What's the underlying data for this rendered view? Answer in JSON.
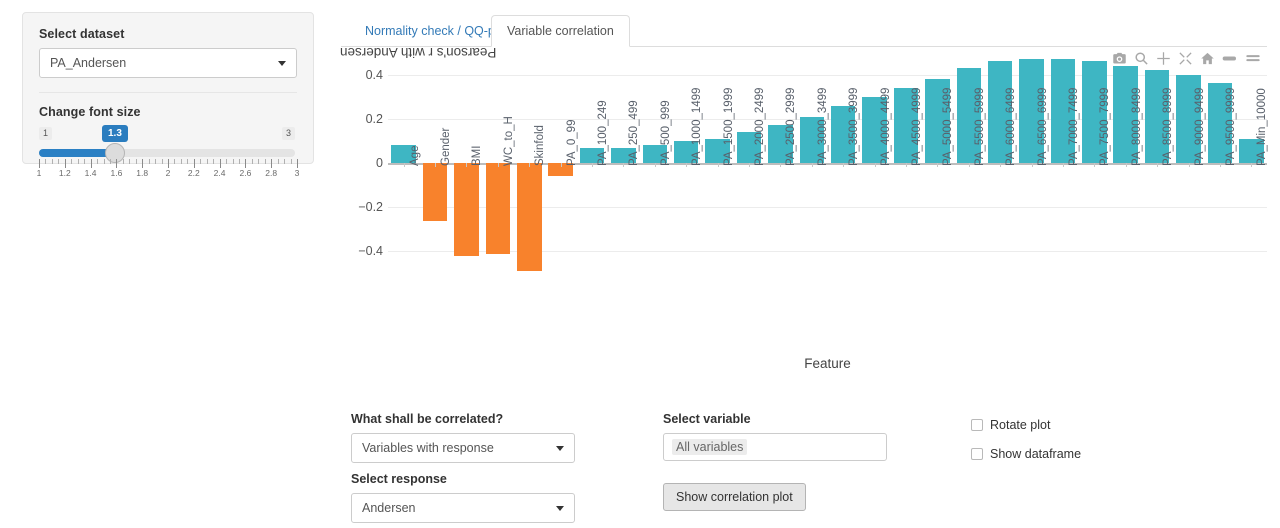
{
  "sidebar": {
    "dataset_label": "Select dataset",
    "dataset_value": "PA_Andersen",
    "fontsize_label": "Change font size",
    "slider": {
      "min_badge": "1",
      "max_badge": "3",
      "value_badge": "1.3",
      "tick_labels": [
        "1",
        "1.2",
        "1.4",
        "1.6",
        "1.8",
        "2",
        "2.2",
        "2.4",
        "2.6",
        "2.8",
        "3"
      ]
    }
  },
  "tabs": [
    {
      "label": "Normality check / QQ-plot",
      "active": false
    },
    {
      "label": "Variable correlation",
      "active": true
    }
  ],
  "modebar": {
    "icons": [
      "camera-icon",
      "zoom-in-icon",
      "pan-icon",
      "autoscale-icon",
      "home-icon",
      "toggle-spikelines-icon",
      "hover-compare-icon"
    ]
  },
  "chart_data": {
    "type": "bar",
    "title": "",
    "xlabel": "Feature",
    "ylabel": "Pearson's r with Andersen",
    "ylim": [
      -0.52,
      0.52
    ],
    "ytick_labels": [
      "0.4",
      "0.2",
      "0",
      "−0.2",
      "−0.4"
    ],
    "yticks": [
      0.4,
      0.2,
      0,
      -0.2,
      -0.4
    ],
    "grid": true,
    "legend": "none",
    "positive_color": "#3eb6c3",
    "negative_color": "#f8822c",
    "categories": [
      "Age",
      "Gender",
      "BMI",
      "WC_to_H",
      "Skinfold",
      "PA_0_99",
      "PA_100_249",
      "PA_250_499",
      "PA_500_999",
      "PA_1000_1499",
      "PA_1500_1999",
      "PA_2000_2499",
      "PA_2500_2999",
      "PA_3000_3499",
      "PA_3500_3999",
      "PA_4000_4499",
      "PA_4500_4999",
      "PA_5000_5499",
      "PA_5500_5999",
      "PA_6000_6499",
      "PA_6500_6999",
      "PA_7000_7499",
      "PA_7500_7999",
      "PA_8000_8499",
      "PA_8500_8999",
      "PA_9000_9499",
      "PA_9500_9999",
      "PA_Min_10000"
    ],
    "values": [
      0.08,
      -0.26,
      -0.42,
      -0.41,
      -0.49,
      -0.06,
      0.07,
      0.07,
      0.08,
      0.1,
      0.11,
      0.14,
      0.17,
      0.21,
      0.26,
      0.3,
      0.34,
      0.38,
      0.43,
      0.46,
      0.47,
      0.47,
      0.46,
      0.44,
      0.42,
      0.4,
      0.36,
      0.11
    ]
  },
  "controls": {
    "correlate_label": "What shall be correlated?",
    "correlate_value": "Variables with response",
    "response_label": "Select response",
    "response_value": "Andersen",
    "variable_label": "Select variable",
    "variable_value": "All variables",
    "show_plot_button": "Show correlation plot",
    "checkboxes": [
      {
        "label": "Rotate plot",
        "checked": false
      },
      {
        "label": "Show dataframe",
        "checked": false
      }
    ]
  }
}
